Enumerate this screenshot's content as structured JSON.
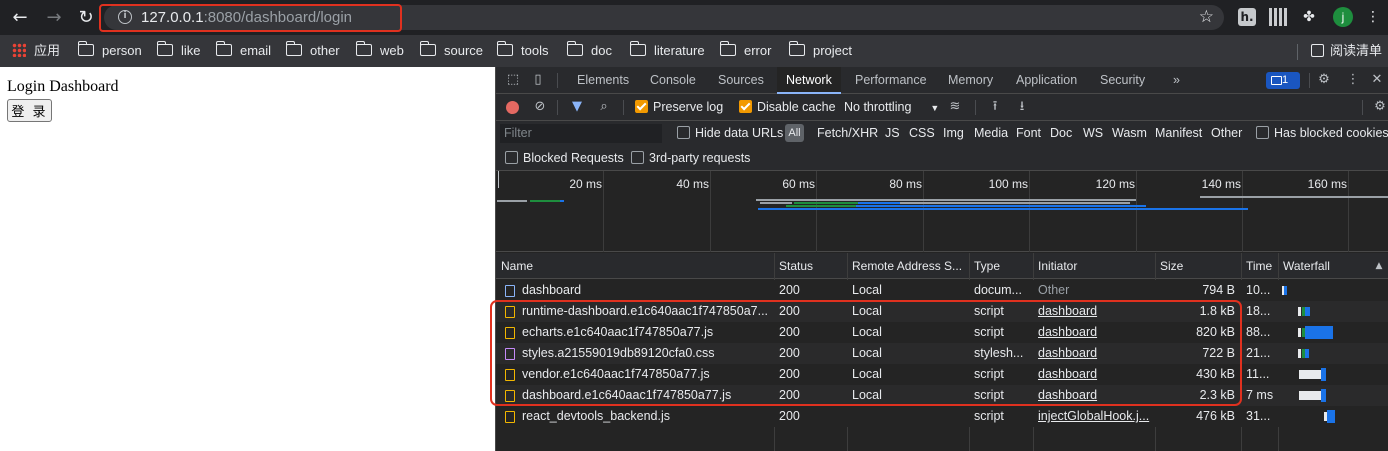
{
  "browser": {
    "url_host": "127.0.0.1",
    "url_rest": ":8080/dashboard/login",
    "avatar_letter": "j",
    "bookmarks": [
      "应用",
      "person",
      "like",
      "email",
      "other",
      "web",
      "source",
      "tools",
      "doc",
      "literature",
      "error",
      "project"
    ],
    "reading_list": "阅读清单",
    "ext_h": "h."
  },
  "page": {
    "title": "Login Dashboard",
    "login_button": "登 录"
  },
  "devtools": {
    "tabs": [
      "Elements",
      "Console",
      "Sources",
      "Network",
      "Performance",
      "Memory",
      "Application",
      "Security"
    ],
    "active_tab": "Network",
    "more_tabs": "»",
    "issues_count": "1",
    "preserve_log": "Preserve log",
    "disable_cache": "Disable cache",
    "throttling": "No throttling",
    "filter_placeholder": "Filter",
    "hide_data_urls": "Hide data URLs",
    "all": "All",
    "filter_types": [
      "Fetch/XHR",
      "JS",
      "CSS",
      "Img",
      "Media",
      "Font",
      "Doc",
      "WS",
      "Wasm",
      "Manifest",
      "Other"
    ],
    "has_blocked_cookies": "Has blocked cookies",
    "blocked_requests": "Blocked Requests",
    "third_party": "3rd-party requests",
    "timeline_ticks": [
      "20 ms",
      "40 ms",
      "60 ms",
      "80 ms",
      "100 ms",
      "120 ms",
      "140 ms",
      "160 ms"
    ],
    "columns": [
      "Name",
      "Status",
      "Remote Address S...",
      "Type",
      "Initiator",
      "Size",
      "Time",
      "Waterfall"
    ],
    "rows": [
      {
        "name": "dashboard",
        "status": "200",
        "remote": "Local",
        "type": "docum...",
        "initiator": "Other",
        "size": "794 B",
        "time": "10...",
        "icon": "doc"
      },
      {
        "name": "runtime-dashboard.e1c640aac1f747850a7...",
        "status": "200",
        "remote": "Local",
        "type": "script",
        "initiator": "dashboard",
        "size": "1.8 kB",
        "time": "18...",
        "icon": "js"
      },
      {
        "name": "echarts.e1c640aac1f747850a77.js",
        "status": "200",
        "remote": "Local",
        "type": "script",
        "initiator": "dashboard",
        "size": "820 kB",
        "time": "88...",
        "icon": "js"
      },
      {
        "name": "styles.a21559019db89120cfa0.css",
        "status": "200",
        "remote": "Local",
        "type": "stylesh...",
        "initiator": "dashboard",
        "size": "722 B",
        "time": "21...",
        "icon": "css"
      },
      {
        "name": "vendor.e1c640aac1f747850a77.js",
        "status": "200",
        "remote": "Local",
        "type": "script",
        "initiator": "dashboard",
        "size": "430 kB",
        "time": "11...",
        "icon": "js"
      },
      {
        "name": "dashboard.e1c640aac1f747850a77.js",
        "status": "200",
        "remote": "Local",
        "type": "script",
        "initiator": "dashboard",
        "size": "2.3 kB",
        "time": "7 ms",
        "icon": "js"
      },
      {
        "name": "react_devtools_backend.js",
        "status": "200",
        "remote": "",
        "type": "script",
        "initiator": "injectGlobalHook.j...",
        "size": "476 kB",
        "time": "31...",
        "icon": "js"
      }
    ]
  },
  "colors": {
    "highlight": "#e0311f",
    "accent": "#8ab4f8",
    "record": "#e46962",
    "checkbox": "#f29900"
  }
}
